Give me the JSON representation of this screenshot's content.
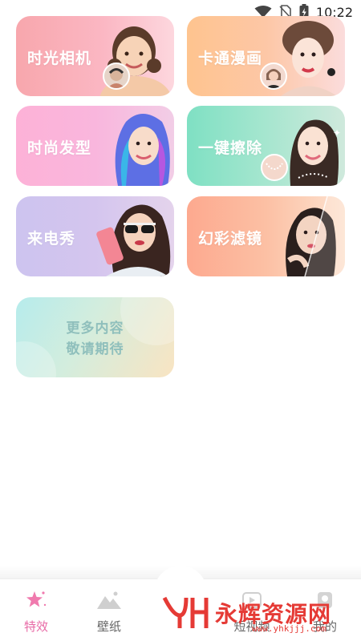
{
  "status_bar": {
    "time": "10:22",
    "icons": [
      "wifi-icon",
      "no-sim-icon",
      "battery-charging-icon"
    ]
  },
  "cards": [
    {
      "id": "time_camera",
      "label": "时光相机"
    },
    {
      "id": "cartoon",
      "label": "卡通漫画"
    },
    {
      "id": "hairstyle",
      "label": "时尚发型"
    },
    {
      "id": "erase",
      "label": "一键擦除"
    },
    {
      "id": "caller_show",
      "label": "来电秀"
    },
    {
      "id": "color_filter",
      "label": "幻彩滤镜"
    }
  ],
  "more_card": {
    "line1": "更多内容",
    "line2": "敬请期待"
  },
  "bottom_nav": {
    "items": [
      {
        "label": "特效",
        "icon": "star-icon",
        "active": true
      },
      {
        "label": "壁纸",
        "icon": "mountain-icon",
        "active": false
      },
      {
        "label": "短视频",
        "icon": "video-icon",
        "active": false
      },
      {
        "label": "我的",
        "icon": "profile-icon",
        "active": false
      }
    ]
  },
  "watermark": {
    "logo_text": "YH",
    "title": "永辉资源网",
    "url": "www.yhkjjj.com"
  },
  "colors": {
    "accent_pink": "#e86aa6",
    "watermark_red": "#e53a35"
  }
}
